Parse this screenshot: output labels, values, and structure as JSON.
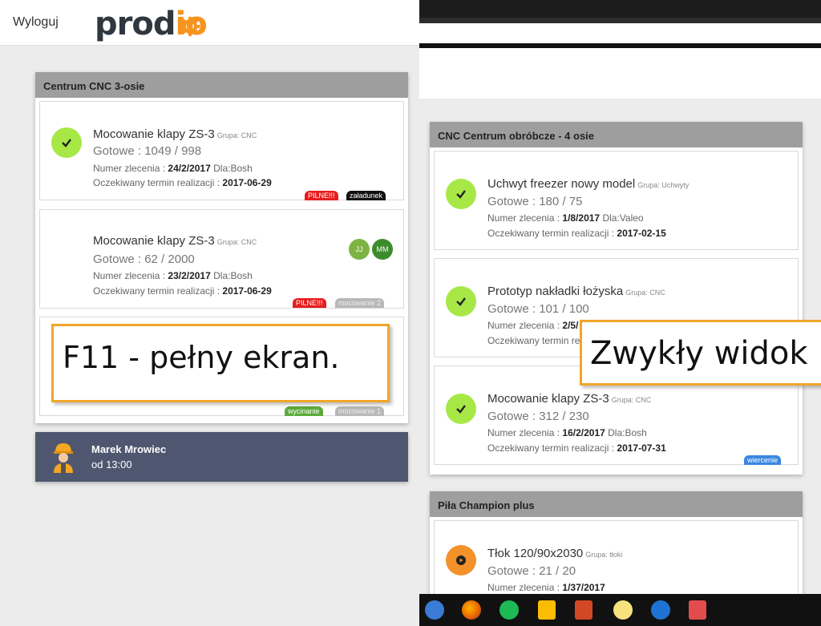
{
  "left": {
    "logout_label": "Wyloguj",
    "logo": {
      "text_start": "prod",
      "text_accent": "io",
      "accent_color": "#f7941d",
      "text_color": "#2f3740"
    },
    "panel_title": "Centrum CNC 3-osie",
    "cards": [
      {
        "title": "Mocowanie klapy ZS-3",
        "group": "Grupa: CNC",
        "ready": "Gotowe : 1049 / 998",
        "order_label": "Numer zlecenia :",
        "order_no": "24/2/2017",
        "client": "Dla:Bosh",
        "deadline_label": "Oczekiwany termin realizacji :",
        "deadline": "2017-06-29",
        "status": "done",
        "tags": [
          "PILNE!!!",
          "załadunek"
        ]
      },
      {
        "title": "Mocowanie klapy ZS-3",
        "group": "Grupa: CNC",
        "ready": "Gotowe : 62 / 2000",
        "order_label": "Numer zlecenia :",
        "order_no": "23/2/2017",
        "client": "Dla:Bosh",
        "deadline_label": "Oczekiwany termin realizacji :",
        "deadline": "2017-06-29",
        "status": "none",
        "avatars": [
          "JJ",
          "MM"
        ],
        "tags": [
          "PILNE!!!",
          "mocowanie 2"
        ]
      },
      {
        "tags": [
          "wycinanie",
          "mocowanie 1"
        ]
      }
    ],
    "callout": "F11 - pełny ekran.",
    "worker": {
      "name": "Marek Mrowiec",
      "since": "od 13:00"
    }
  },
  "right": {
    "panel_title": "CNC Centrum obróbcze - 4 osie",
    "cards": [
      {
        "title": "Uchwyt freezer nowy model",
        "group": "Grupa: Uchwyty",
        "ready": "Gotowe : 180 / 75",
        "order_label": "Numer zlecenia :",
        "order_no": "1/8/2017",
        "client": "Dla:Valeo",
        "deadline_label": "Oczekiwany termin realizacji :",
        "deadline": "2017-02-15",
        "status": "done"
      },
      {
        "title": "Prototyp nakładki łożyska",
        "group": "Grupa: CNC",
        "ready": "Gotowe : 101 / 100",
        "order_label": "Numer zlecenia :",
        "order_no": "2/5/",
        "deadline_label": "Oczekiwany termin re",
        "status": "done"
      },
      {
        "title": "Mocowanie klapy ZS-3",
        "group": "Grupa: CNC",
        "ready": "Gotowe : 312 / 230",
        "order_label": "Numer zlecenia :",
        "order_no": "16/2/2017",
        "client": "Dla:Bosh",
        "deadline_label": "Oczekiwany termin realizacji :",
        "deadline": "2017-07-31",
        "status": "done",
        "tags": [
          "wiercenie"
        ]
      }
    ],
    "panel2_title": "Piła Champion plus",
    "panel2_card": {
      "title": "Tłok 120/90x2030",
      "group": "Grupa: tłoki",
      "ready": "Gotowe : 21 / 20",
      "order_label": "Numer zlecenia :",
      "order_no": "1/37/2017",
      "status": "in-progress"
    },
    "callout": "Zwykły widok",
    "taskbar_icons": [
      "windows-start-icon",
      "firefox-icon",
      "spotify-icon",
      "keep-icon",
      "powerpoint-icon",
      "notes-icon",
      "edge-icon",
      "screenshot-icon"
    ]
  },
  "colors": {
    "panel_header": "#9e9e9e",
    "check_green": "#a7e847",
    "play_orange": "#f3922a",
    "callout_border": "#f0a629",
    "worker_bar": "#4f5770",
    "tag_red": "#e81c1c",
    "tag_blue": "#3b86e0"
  }
}
